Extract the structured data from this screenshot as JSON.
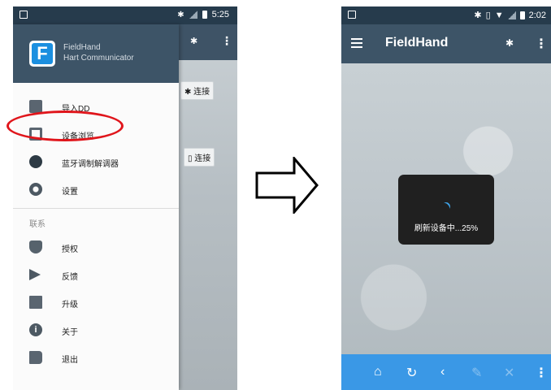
{
  "left_screen": {
    "status_bar": {
      "time": "5:25"
    },
    "drawer": {
      "app_name": "FieldHand",
      "app_subtitle": "Hart Communicator",
      "items": [
        {
          "label": "导入DD",
          "icon": "import-icon"
        },
        {
          "label": "设备浏览",
          "icon": "device-browse-icon"
        },
        {
          "label": "蓝牙调制解调器",
          "icon": "bluetooth-icon"
        },
        {
          "label": "设置",
          "icon": "gear-icon"
        }
      ],
      "section_title": "联系",
      "contact_items": [
        {
          "label": "授权",
          "icon": "shield-icon"
        },
        {
          "label": "反馈",
          "icon": "send-icon"
        },
        {
          "label": "升级",
          "icon": "upgrade-icon"
        },
        {
          "label": "关于",
          "icon": "info-icon"
        },
        {
          "label": "退出",
          "icon": "exit-icon"
        }
      ]
    },
    "background": {
      "bluetooth_connect_label": "连接",
      "usb_connect_label": "连接"
    }
  },
  "right_screen": {
    "status_bar": {
      "time": "2:02"
    },
    "app_title": "FieldHand",
    "progress_text": "刷新设备中...25%",
    "progress_percent": 25,
    "bottom_nav": [
      "home-icon",
      "refresh-icon",
      "back-icon",
      "edit-icon",
      "close-icon",
      "more-icon"
    ]
  },
  "colors": {
    "appbar": "#3d5467",
    "status_bar": "#263b4c",
    "bottom_bar": "#3a98e6",
    "highlight": "#e0151b",
    "logo_blue": "#1b8fe0"
  }
}
